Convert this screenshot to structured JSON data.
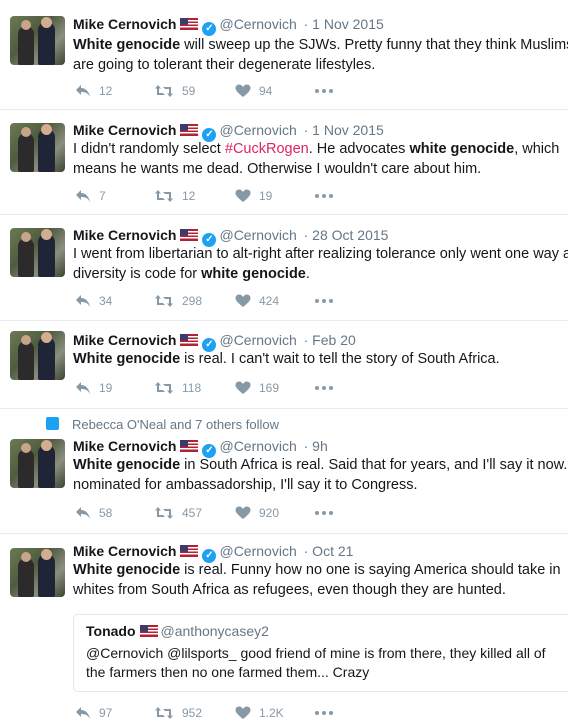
{
  "tweets": [
    {
      "name": "Mike Cernovich",
      "handle": "@Cernovich",
      "date": "· 1 Nov 2015",
      "bold": "White genocide",
      "line1_rest": " will sweep up the SJWs. Pretty funny that they think Muslims",
      "line2": "are going to tolerant their degenerate lifestyles.",
      "replies": "12",
      "retweets": "59",
      "likes": "94"
    },
    {
      "name": "Mike Cernovich",
      "handle": "@Cernovich",
      "date": "· 1 Nov 2015",
      "line1_pre": "I didn't randomly select ",
      "hashtag": "#CuckRogen",
      "line1_mid": ". He advocates ",
      "bold": "white genocide",
      "line1_post": ", which",
      "line2": "means he wants me dead. Otherwise I wouldn't care about him.",
      "replies": "7",
      "retweets": "12",
      "likes": "19"
    },
    {
      "name": "Mike Cernovich",
      "handle": "@Cernovich",
      "date": "· 28 Oct 2015",
      "line1": "I went from libertarian to alt-right after realizing tolerance only went one way and",
      "line2_pre": "diversity is code for ",
      "bold": "white genocide",
      "line2_post": ".",
      "replies": "34",
      "retweets": "298",
      "likes": "424"
    },
    {
      "name": "Mike Cernovich",
      "handle": "@Cernovich",
      "date": "· Feb 20",
      "bold": "White genocide",
      "line1_rest": " is real. I can't wait to tell the story of South Africa.",
      "replies": "19",
      "retweets": "118",
      "likes": "169"
    },
    {
      "context": "Rebecca O'Neal and 7 others follow",
      "name": "Mike Cernovich",
      "handle": "@Cernovich",
      "date": "· 9h",
      "bold": "White genocide",
      "line1_rest": " in South Africa is real. Said that for years, and I'll say it now. If",
      "line2": "nominated for ambassadorship, I'll say it to Congress.",
      "replies": "58",
      "retweets": "457",
      "likes": "920"
    },
    {
      "name": "Mike Cernovich",
      "handle": "@Cernovich",
      "date": "· Oct 21",
      "bold": "White genocide",
      "line1_rest": " is real. Funny how no one is saying America should take in",
      "line2": "whites from South Africa as refugees, even though they are hunted.",
      "quote": {
        "name": "Tonado",
        "handle": "@anthonycasey2",
        "line1": "@Cernovich @lilsports_ good friend of mine is from there, they killed all of",
        "line2": "the farmers then no one farmed them... Crazy"
      },
      "replies": "97",
      "retweets": "952",
      "likes": "1.2K"
    }
  ],
  "colors": {
    "link_blue": "#1da1f2",
    "hashtag": "#e0245e",
    "meta_gray": "#657786",
    "icon_gray": "#8899a6"
  }
}
